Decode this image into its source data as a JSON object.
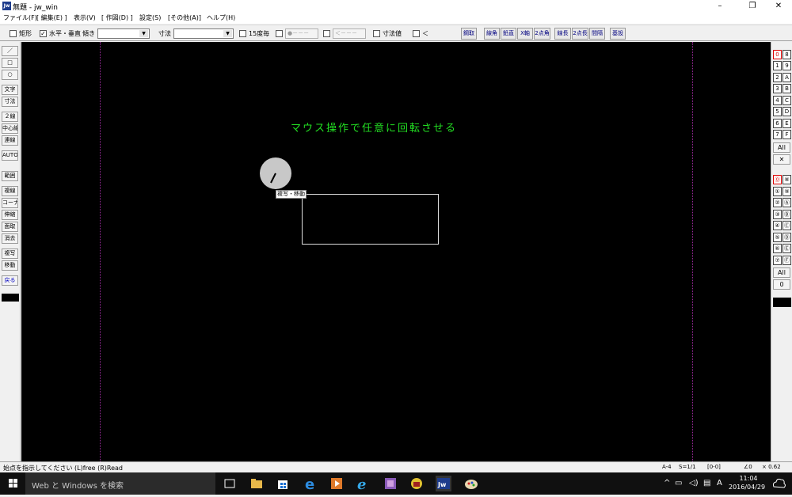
{
  "window": {
    "icon_text": "Jw",
    "title": "無題 - jw_win",
    "minimize": "–",
    "restore": "❐",
    "close": "✕"
  },
  "menu": [
    "ファイル(F)",
    "[ 編集(E) ]",
    "表示(V)",
    "[ 作図(D) ]",
    "設定(S)",
    "[その他(A)]",
    "ヘルプ(H)"
  ],
  "toolbar": {
    "rect_label": "矩形",
    "horizontal_vertical_label": "水平・垂直",
    "tilt_label": "傾き",
    "dimension_label": "寸法",
    "deg15_label": "15度毎",
    "point_button": "●－－－",
    "arrow_button": "＜－－－",
    "dim_value_label": "寸法値",
    "less_than_label": "＜",
    "right_buttons": [
      "鋼取",
      "線角",
      "鉛直",
      "X軸",
      "2点角",
      "線長",
      "2点長",
      "間隔",
      "基設"
    ]
  },
  "left_tools": [
    "／",
    "□",
    "○",
    "文字",
    "寸法",
    "２線",
    "中心線",
    "連線",
    "AUTO",
    "範囲",
    "複線",
    "コーナー",
    "伸縮",
    "面取",
    "消去",
    "複写",
    "移動",
    "戻る"
  ],
  "right_layers": {
    "groups_top": [
      [
        "0",
        "8"
      ],
      [
        "1",
        "9"
      ],
      [
        "2",
        "A"
      ],
      [
        "3",
        "B"
      ],
      [
        "4",
        "C"
      ],
      [
        "5",
        "D"
      ],
      [
        "6",
        "E"
      ],
      [
        "7",
        "F"
      ]
    ],
    "all_label": "All",
    "x_label": "✕",
    "groups_bottom": [
      [
        "⓪",
        "⑧"
      ],
      [
        "①",
        "⑨"
      ],
      [
        "②",
        "Ⓐ"
      ],
      [
        "③",
        "Ⓑ"
      ],
      [
        "④",
        "Ⓒ"
      ],
      [
        "⑤",
        "Ⓓ"
      ],
      [
        "⑥",
        "Ⓔ"
      ],
      [
        "⑦",
        "Ⓕ"
      ]
    ],
    "all_label_2": "All",
    "zero_label": "0"
  },
  "canvas": {
    "instruction": "マウス操作で任意に回転させる",
    "dial_tag": "複写・移動"
  },
  "status": {
    "message": "始点を指示してください (L)free (R)Read",
    "paper": "A-4",
    "scale": "S=1/1",
    "layer": "[0-0]",
    "angle": "∠0",
    "zoom": "× 0.62"
  },
  "taskbar": {
    "search_placeholder": "Web と Windows を検索",
    "time": "11:04",
    "date": "2016/04/29",
    "ime": "A"
  }
}
